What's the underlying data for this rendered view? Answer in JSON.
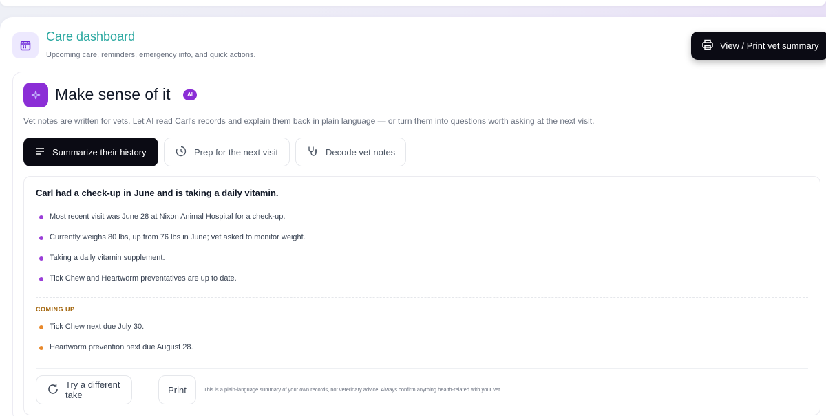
{
  "header": {
    "title": "Care dashboard",
    "subtitle": "Upcoming care, reminders, emergency info, and quick actions.",
    "print_button_label": "View / Print vet summary"
  },
  "ai_section": {
    "title": "Make sense of it",
    "badge": "AI",
    "description": "Vet notes are written for vets. Let AI read Carl's records and explain them back in plain language — or turn them into questions worth asking at the next visit.",
    "tabs": [
      {
        "label": "Summarize their history",
        "icon": "lines-icon",
        "active": true
      },
      {
        "label": "Prep for the next visit",
        "icon": "clock-icon",
        "active": false
      },
      {
        "label": "Decode vet notes",
        "icon": "stethoscope-icon",
        "active": false
      }
    ]
  },
  "result": {
    "heading": "Carl had a check-up in June and is taking a daily vitamin.",
    "bullets": [
      "Most recent visit was June 28 at Nixon Animal Hospital for a check-up.",
      "Currently weighs 80 lbs, up from 76 lbs in June; vet asked to monitor weight.",
      "Taking a daily vitamin supplement.",
      "Tick Chew and Heartworm preventatives are up to date."
    ],
    "coming_up_label": "COMING UP",
    "coming_up": [
      "Tick Chew next due July 30.",
      "Heartworm prevention next due August 28."
    ],
    "retry_label": "Try a different take",
    "print_label": "Print",
    "disclaimer": "This is a plain-language summary of your own records, not veterinary advice. Always confirm anything health-related with your vet."
  },
  "colors": {
    "accent_purple": "#8b2ed6",
    "title_teal": "#2aa8a0",
    "dark_button": "#0b0b14",
    "coming_up_orange": "#e8892c"
  }
}
